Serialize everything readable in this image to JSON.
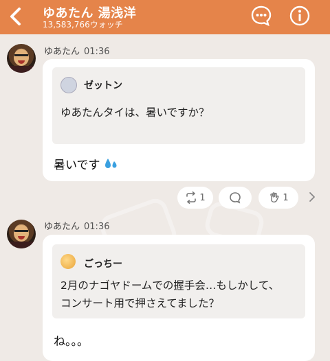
{
  "header": {
    "title": "ゆあたん 湯浅洋",
    "watch_count": "13,583,766ウォッチ"
  },
  "messages": [
    {
      "author": "ゆあたん",
      "time": "01:36",
      "quote": {
        "name": "ゼットン",
        "text": "ゆあたんタイは、暑いですか？"
      },
      "reply": "暑いです",
      "reactions": {
        "repost_count": "1",
        "like_count": "1"
      }
    },
    {
      "author": "ゆあたん",
      "time": "01:36",
      "quote": {
        "name": "ごっちー",
        "text_line1": "2月のナゴヤドームでの握手会…もしかして、",
        "text_line2": "コンサート用で押さえてました？"
      },
      "reply": "ね。。。"
    }
  ],
  "colors": {
    "header": "#e5844a",
    "background": "#efeae6"
  }
}
